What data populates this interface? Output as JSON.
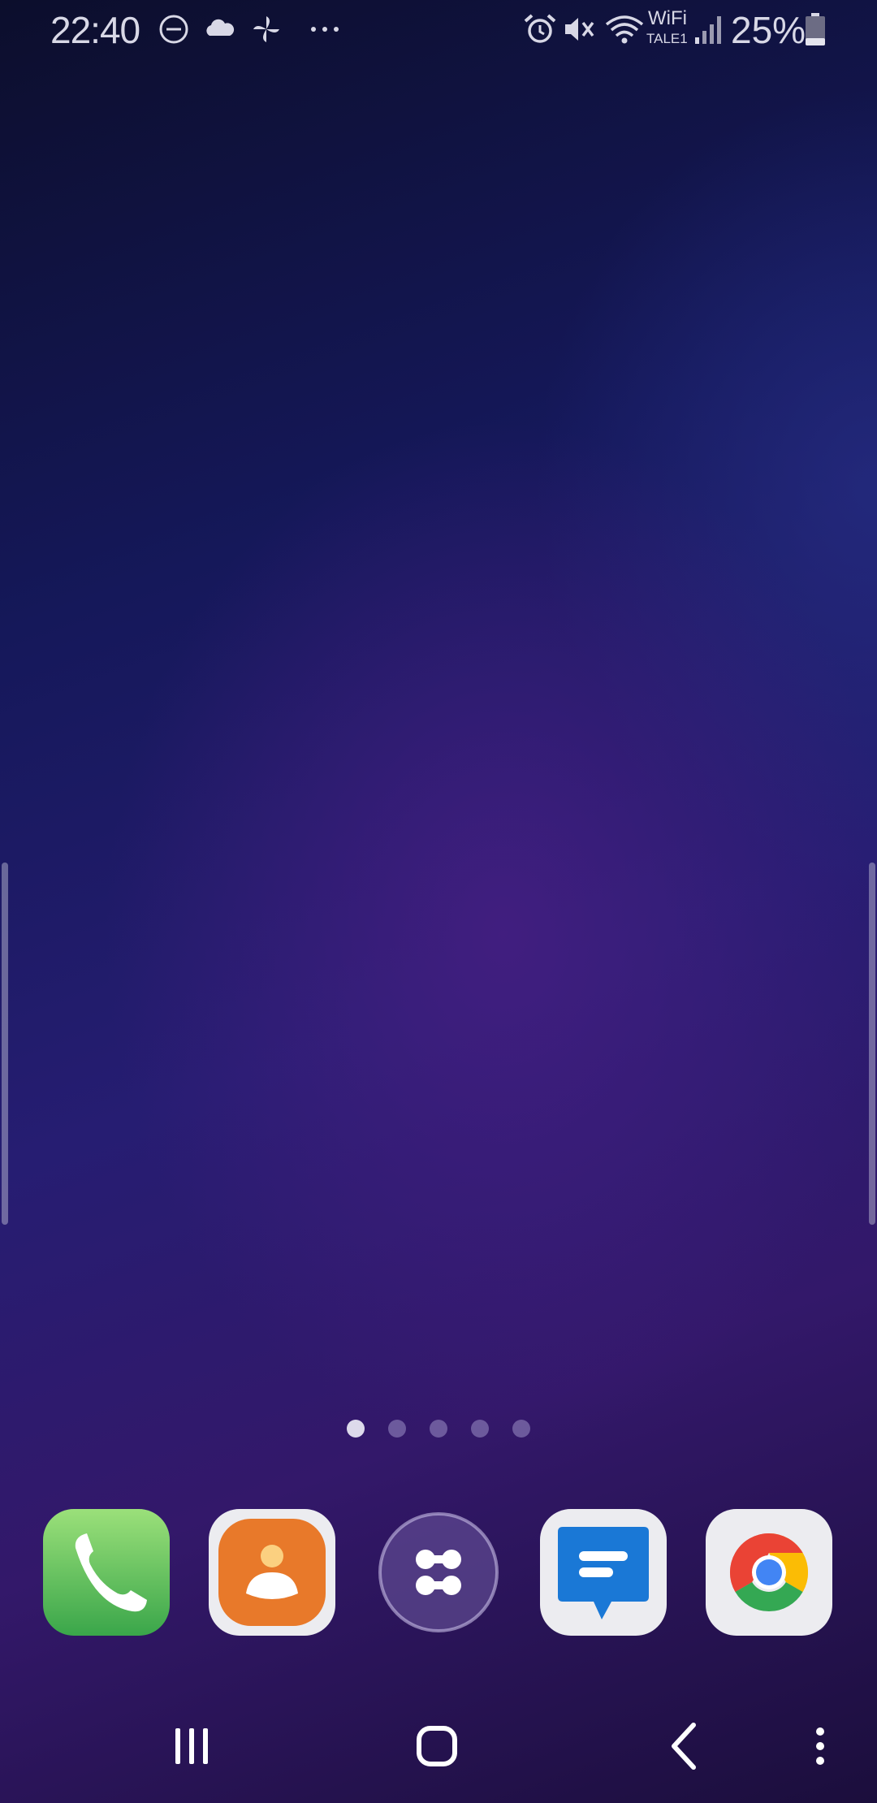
{
  "status_bar": {
    "time": "22:40",
    "wifi_label": "WiFi",
    "wifi_sub": "TALE1",
    "battery_percent": "25%",
    "left_icons": [
      "dnd-icon",
      "cloud-icon",
      "pinwheel-icon",
      "more-notifications-icon"
    ],
    "right_icons": [
      "alarm-icon",
      "mute-icon",
      "wifi-icon",
      "signal-icon",
      "battery-icon"
    ]
  },
  "home": {
    "pages": 5,
    "active_page": 1
  },
  "dock": {
    "apps": [
      {
        "name": "Phone",
        "icon": "phone-icon",
        "color": "#5cc85a"
      },
      {
        "name": "Contacts",
        "icon": "contacts-icon",
        "color": "#e8792a"
      },
      {
        "name": "Apps",
        "icon": "apps-icon",
        "color": "#5a4a8c"
      },
      {
        "name": "Messages",
        "icon": "messages-icon",
        "color": "#1a78d6"
      },
      {
        "name": "Chrome",
        "icon": "chrome-icon",
        "color": "#ea4335"
      }
    ]
  },
  "nav_bar": {
    "buttons": [
      "recents-icon",
      "home-icon",
      "back-icon",
      "menu-icon"
    ]
  }
}
